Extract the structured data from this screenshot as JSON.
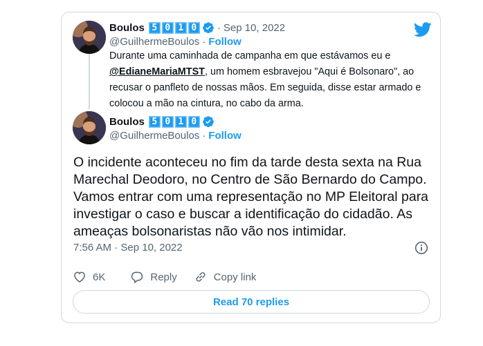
{
  "quoted_tweet": {
    "name": "Boulos",
    "badge_digits": [
      "5",
      "0",
      "1",
      "0"
    ],
    "date": "Sep 10, 2022",
    "handle": "@GuilhermeBoulos",
    "follow_label": "Follow",
    "separator": "·",
    "text_before_mention": "Durante uma caminhada de campanha em que estávamos eu e ",
    "mention": "@EdianeMariaMTST",
    "text_after_mention": ", um homem esbravejou \"Aqui é Bolsonaro\", ao recusar o panfleto de nossas mãos. Em seguida, disse estar armado e colocou a mão na cintura, no cabo da arma."
  },
  "main_tweet": {
    "name": "Boulos",
    "badge_digits": [
      "5",
      "0",
      "1",
      "0"
    ],
    "handle": "@GuilhermeBoulos",
    "separator": "·",
    "follow_label": "Follow",
    "text": "O incidente aconteceu no fim da tarde desta sexta na Rua Marechal Deodoro, no Centro de São Bernardo do Campo. Vamos entrar com uma representação no MP Eleitoral para investigar o caso e buscar a identificação do cidadão. As ameaças bolsonaristas não vão nos intimidar.",
    "timestamp": "7:56 AM · Sep 10, 2022",
    "likes": "6K",
    "reply_label": "Reply",
    "copy_link_label": "Copy link",
    "read_replies_label": "Read 70 replies"
  },
  "icons": {
    "logo": "twitter-bird-icon",
    "verified": "verified-badge-icon",
    "info": "info-icon",
    "like": "heart-icon",
    "reply": "reply-bubble-icon",
    "copy_link": "link-icon"
  },
  "colors": {
    "accent": "#1d9bf0",
    "text_primary": "#0f1419",
    "text_secondary": "#536471",
    "border": "#cfd9de"
  }
}
